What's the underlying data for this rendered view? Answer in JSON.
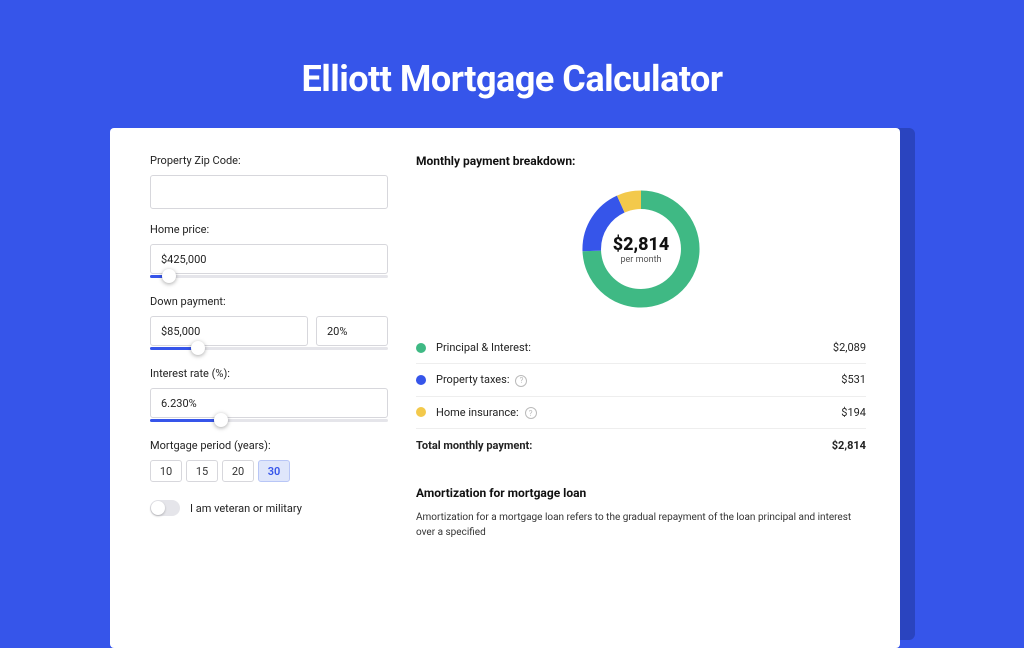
{
  "title": "Elliott Mortgage Calculator",
  "form": {
    "zip_label": "Property Zip Code:",
    "zip_value": "",
    "home_price_label": "Home price:",
    "home_price_value": "$425,000",
    "home_price_slider_pct": 8,
    "down_payment_label": "Down payment:",
    "down_payment_value": "$85,000",
    "down_payment_pct_value": "20%",
    "down_payment_slider_pct": 20,
    "interest_label": "Interest rate (%):",
    "interest_value": "6.230%",
    "interest_slider_pct": 30,
    "period_label": "Mortgage period (years):",
    "periods": [
      {
        "label": "10",
        "active": false
      },
      {
        "label": "15",
        "active": false
      },
      {
        "label": "20",
        "active": false
      },
      {
        "label": "30",
        "active": true
      }
    ],
    "veteran_label": "I am veteran or military"
  },
  "breakdown": {
    "title": "Monthly payment breakdown:",
    "center_amount": "$2,814",
    "center_sub": "per month",
    "items": [
      {
        "label": "Principal & Interest:",
        "value": "$2,089",
        "color": "green",
        "info": false
      },
      {
        "label": "Property taxes:",
        "value": "$531",
        "color": "blue",
        "info": true
      },
      {
        "label": "Home insurance:",
        "value": "$194",
        "color": "yellow",
        "info": true
      }
    ],
    "total_label": "Total monthly payment:",
    "total_value": "$2,814"
  },
  "chart_data": {
    "type": "pie",
    "title": "Monthly payment breakdown",
    "series": [
      {
        "name": "Principal & Interest",
        "value": 2089,
        "color": "#3fb984"
      },
      {
        "name": "Property taxes",
        "value": 531,
        "color": "#3655ea"
      },
      {
        "name": "Home insurance",
        "value": 194,
        "color": "#f3c94b"
      }
    ],
    "total": 2814
  },
  "amort": {
    "title": "Amortization for mortgage loan",
    "text": "Amortization for a mortgage loan refers to the gradual repayment of the loan principal and interest over a specified"
  }
}
